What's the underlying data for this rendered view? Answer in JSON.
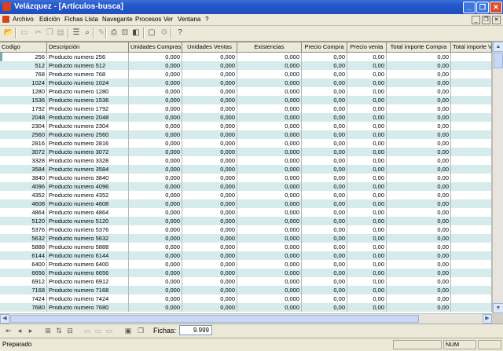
{
  "window": {
    "title": "Velázquez - [Artículos-busca]",
    "minimize_glyph": "_",
    "restore_glyph": "❐",
    "close_glyph": "✕"
  },
  "menu": {
    "items": [
      "Archivo",
      "Edición",
      "Fichas",
      "Lista",
      "Navegante",
      "Procesos",
      "Ver",
      "Ventana",
      "?"
    ]
  },
  "toolbar": {
    "icons": [
      {
        "name": "open-folder-icon",
        "glyph": "📂",
        "enabled": true
      },
      {
        "name": "new-record-icon",
        "glyph": "▭",
        "enabled": false
      },
      {
        "name": "cut-icon",
        "glyph": "✂",
        "enabled": false
      },
      {
        "name": "copy-icon",
        "glyph": "❐",
        "enabled": false
      },
      {
        "name": "paste-icon",
        "glyph": "▤",
        "enabled": false
      },
      {
        "name": "list-icon",
        "glyph": "☰",
        "enabled": true
      },
      {
        "name": "find-icon",
        "glyph": "⌕",
        "enabled": true
      },
      {
        "name": "edit-icon",
        "glyph": "✎",
        "enabled": false
      },
      {
        "name": "print-icon",
        "glyph": "⎙",
        "enabled": true
      },
      {
        "name": "print-preview-icon",
        "glyph": "⊡",
        "enabled": true
      },
      {
        "name": "page-setup-icon",
        "glyph": "◧",
        "enabled": true
      },
      {
        "name": "window-icon",
        "glyph": "▢",
        "enabled": true
      },
      {
        "name": "tools-icon",
        "glyph": "⚙",
        "enabled": false
      },
      {
        "name": "help-icon",
        "glyph": "?",
        "enabled": true
      }
    ]
  },
  "grid": {
    "columns": [
      "Codigo",
      "Descripción",
      "Unidades Compras",
      "Unidades Ventas",
      "Existencias",
      "Precio Compra",
      "Precio venta",
      "Total importe Compra",
      "Total importe V"
    ],
    "rows": [
      [
        "256",
        "Producto numero   256",
        "0,000",
        "0,000",
        "0,000",
        "0,00",
        "0,00",
        "0,00",
        ""
      ],
      [
        "512",
        "Producto numero   512",
        "0,000",
        "0,000",
        "0,000",
        "0,00",
        "0,00",
        "0,00",
        ""
      ],
      [
        "768",
        "Producto numero   768",
        "0,000",
        "0,000",
        "0,000",
        "0,00",
        "0,00",
        "0,00",
        ""
      ],
      [
        "1024",
        "Producto numero   1024",
        "0,000",
        "0,000",
        "0,000",
        "0,00",
        "0,00",
        "0,00",
        ""
      ],
      [
        "1280",
        "Producto numero   1280",
        "0,000",
        "0,000",
        "0,000",
        "0,00",
        "0,00",
        "0,00",
        ""
      ],
      [
        "1536",
        "Producto numero   1536",
        "0,000",
        "0,000",
        "0,000",
        "0,00",
        "0,00",
        "0,00",
        ""
      ],
      [
        "1792",
        "Producto numero   1792",
        "0,000",
        "0,000",
        "0,000",
        "0,00",
        "0,00",
        "0,00",
        ""
      ],
      [
        "2048",
        "Producto numero   2048",
        "0,000",
        "0,000",
        "0,000",
        "0,00",
        "0,00",
        "0,00",
        ""
      ],
      [
        "2304",
        "Producto numero   2304",
        "0,000",
        "0,000",
        "0,000",
        "0,00",
        "0,00",
        "0,00",
        ""
      ],
      [
        "2560",
        "Producto numero   2560",
        "0,000",
        "0,000",
        "0,000",
        "0,00",
        "0,00",
        "0,00",
        ""
      ],
      [
        "2816",
        "Producto numero   2816",
        "0,000",
        "0,000",
        "0,000",
        "0,00",
        "0,00",
        "0,00",
        ""
      ],
      [
        "3072",
        "Producto numero   3072",
        "0,000",
        "0,000",
        "0,000",
        "0,00",
        "0,00",
        "0,00",
        ""
      ],
      [
        "3328",
        "Producto numero   3328",
        "0,000",
        "0,000",
        "0,000",
        "0,00",
        "0,00",
        "0,00",
        ""
      ],
      [
        "3584",
        "Producto numero   3584",
        "0,000",
        "0,000",
        "0,000",
        "0,00",
        "0,00",
        "0,00",
        ""
      ],
      [
        "3840",
        "Producto numero   3840",
        "0,000",
        "0,000",
        "0,000",
        "0,00",
        "0,00",
        "0,00",
        ""
      ],
      [
        "4096",
        "Producto numero   4096",
        "0,000",
        "0,000",
        "0,000",
        "0,00",
        "0,00",
        "0,00",
        ""
      ],
      [
        "4352",
        "Producto numero   4352",
        "0,000",
        "0,000",
        "0,000",
        "0,00",
        "0,00",
        "0,00",
        ""
      ],
      [
        "4608",
        "Producto numero   4608",
        "0,000",
        "0,000",
        "0,000",
        "0,00",
        "0,00",
        "0,00",
        ""
      ],
      [
        "4864",
        "Producto numero   4864",
        "0,000",
        "0,000",
        "0,000",
        "0,00",
        "0,00",
        "0,00",
        ""
      ],
      [
        "5120",
        "Producto numero   5120",
        "0,000",
        "0,000",
        "0,000",
        "0,00",
        "0,00",
        "0,00",
        ""
      ],
      [
        "5376",
        "Producto numero   5376",
        "0,000",
        "0,000",
        "0,000",
        "0,00",
        "0,00",
        "0,00",
        ""
      ],
      [
        "5632",
        "Producto numero   5632",
        "0,000",
        "0,000",
        "0,000",
        "0,00",
        "0,00",
        "0,00",
        ""
      ],
      [
        "5888",
        "Producto numero   5888",
        "0,000",
        "0,000",
        "0,000",
        "0,00",
        "0,00",
        "0,00",
        ""
      ],
      [
        "6144",
        "Producto numero   6144",
        "0,000",
        "0,000",
        "0,000",
        "0,00",
        "0,00",
        "0,00",
        ""
      ],
      [
        "6400",
        "Producto numero   6400",
        "0,000",
        "0,000",
        "0,000",
        "0,00",
        "0,00",
        "0,00",
        ""
      ],
      [
        "6656",
        "Producto numero   6656",
        "0,000",
        "0,000",
        "0,000",
        "0,00",
        "0,00",
        "0,00",
        ""
      ],
      [
        "6912",
        "Producto numero   6912",
        "0,000",
        "0,000",
        "0,000",
        "0,00",
        "0,00",
        "0,00",
        ""
      ],
      [
        "7168",
        "Producto numero   7168",
        "0,000",
        "0,000",
        "0,000",
        "0,00",
        "0,00",
        "0,00",
        ""
      ],
      [
        "7424",
        "Producto numero   7424",
        "0,000",
        "0,000",
        "0,000",
        "0,00",
        "0,00",
        "0,00",
        ""
      ],
      [
        "7680",
        "Producto numero   7680",
        "0,000",
        "0,000",
        "0,000",
        "0,00",
        "0,00",
        "0,00",
        ""
      ]
    ]
  },
  "navigation": {
    "buttons": [
      {
        "name": "first-record-icon",
        "glyph": "⇤",
        "enabled": true
      },
      {
        "name": "previous-page-icon",
        "glyph": "◂",
        "enabled": true
      },
      {
        "name": "next-page-icon",
        "glyph": "▸",
        "enabled": true
      },
      {
        "name": "tree-view-icon",
        "glyph": "⊞",
        "enabled": true
      },
      {
        "name": "sort-icon",
        "glyph": "⇅",
        "enabled": true
      },
      {
        "name": "filter-icon",
        "glyph": "⊟",
        "enabled": true
      },
      {
        "name": "insert-record-icon",
        "glyph": "▭",
        "enabled": false
      },
      {
        "name": "delete-record-icon",
        "glyph": "▭",
        "enabled": false
      },
      {
        "name": "edit-record-icon",
        "glyph": "▭",
        "enabled": false
      },
      {
        "name": "export-icon",
        "glyph": "▣",
        "enabled": true
      },
      {
        "name": "duplicate-icon",
        "glyph": "❐",
        "enabled": true
      }
    ],
    "fichas_label": "Fichas:",
    "fichas_count": "9.999"
  },
  "status": {
    "text": "Preparado",
    "num": "NUM"
  },
  "colors": {
    "row_alt": "#d6ecec",
    "titlebar": "#2457c8"
  }
}
